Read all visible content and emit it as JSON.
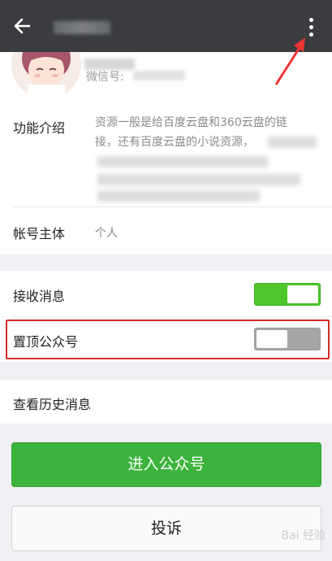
{
  "header": {
    "back_icon": "arrow-left-icon",
    "more_icon": "more-vertical-icon"
  },
  "profile": {
    "wechat_id_label": "微信号:"
  },
  "intro": {
    "label": "功能介绍",
    "line1": "资源一般是给百度云盘和360云盘的链",
    "line2": "接，还有百度云盘的小说资源，"
  },
  "account": {
    "label": "帐号主体",
    "value": "个人"
  },
  "settings": {
    "receive_label": "接收消息",
    "receive_on": true,
    "pin_label": "置顶公众号",
    "pin_on": false
  },
  "history": {
    "label": "查看历史消息"
  },
  "buttons": {
    "enter": "进入公众号",
    "report": "投诉"
  },
  "watermark": "Bai 经验",
  "colors": {
    "topbar": "#3a3c3f",
    "toggle_on": "#4cc62a",
    "primary_button": "#3cb33c",
    "highlight": "#d12b2b"
  }
}
